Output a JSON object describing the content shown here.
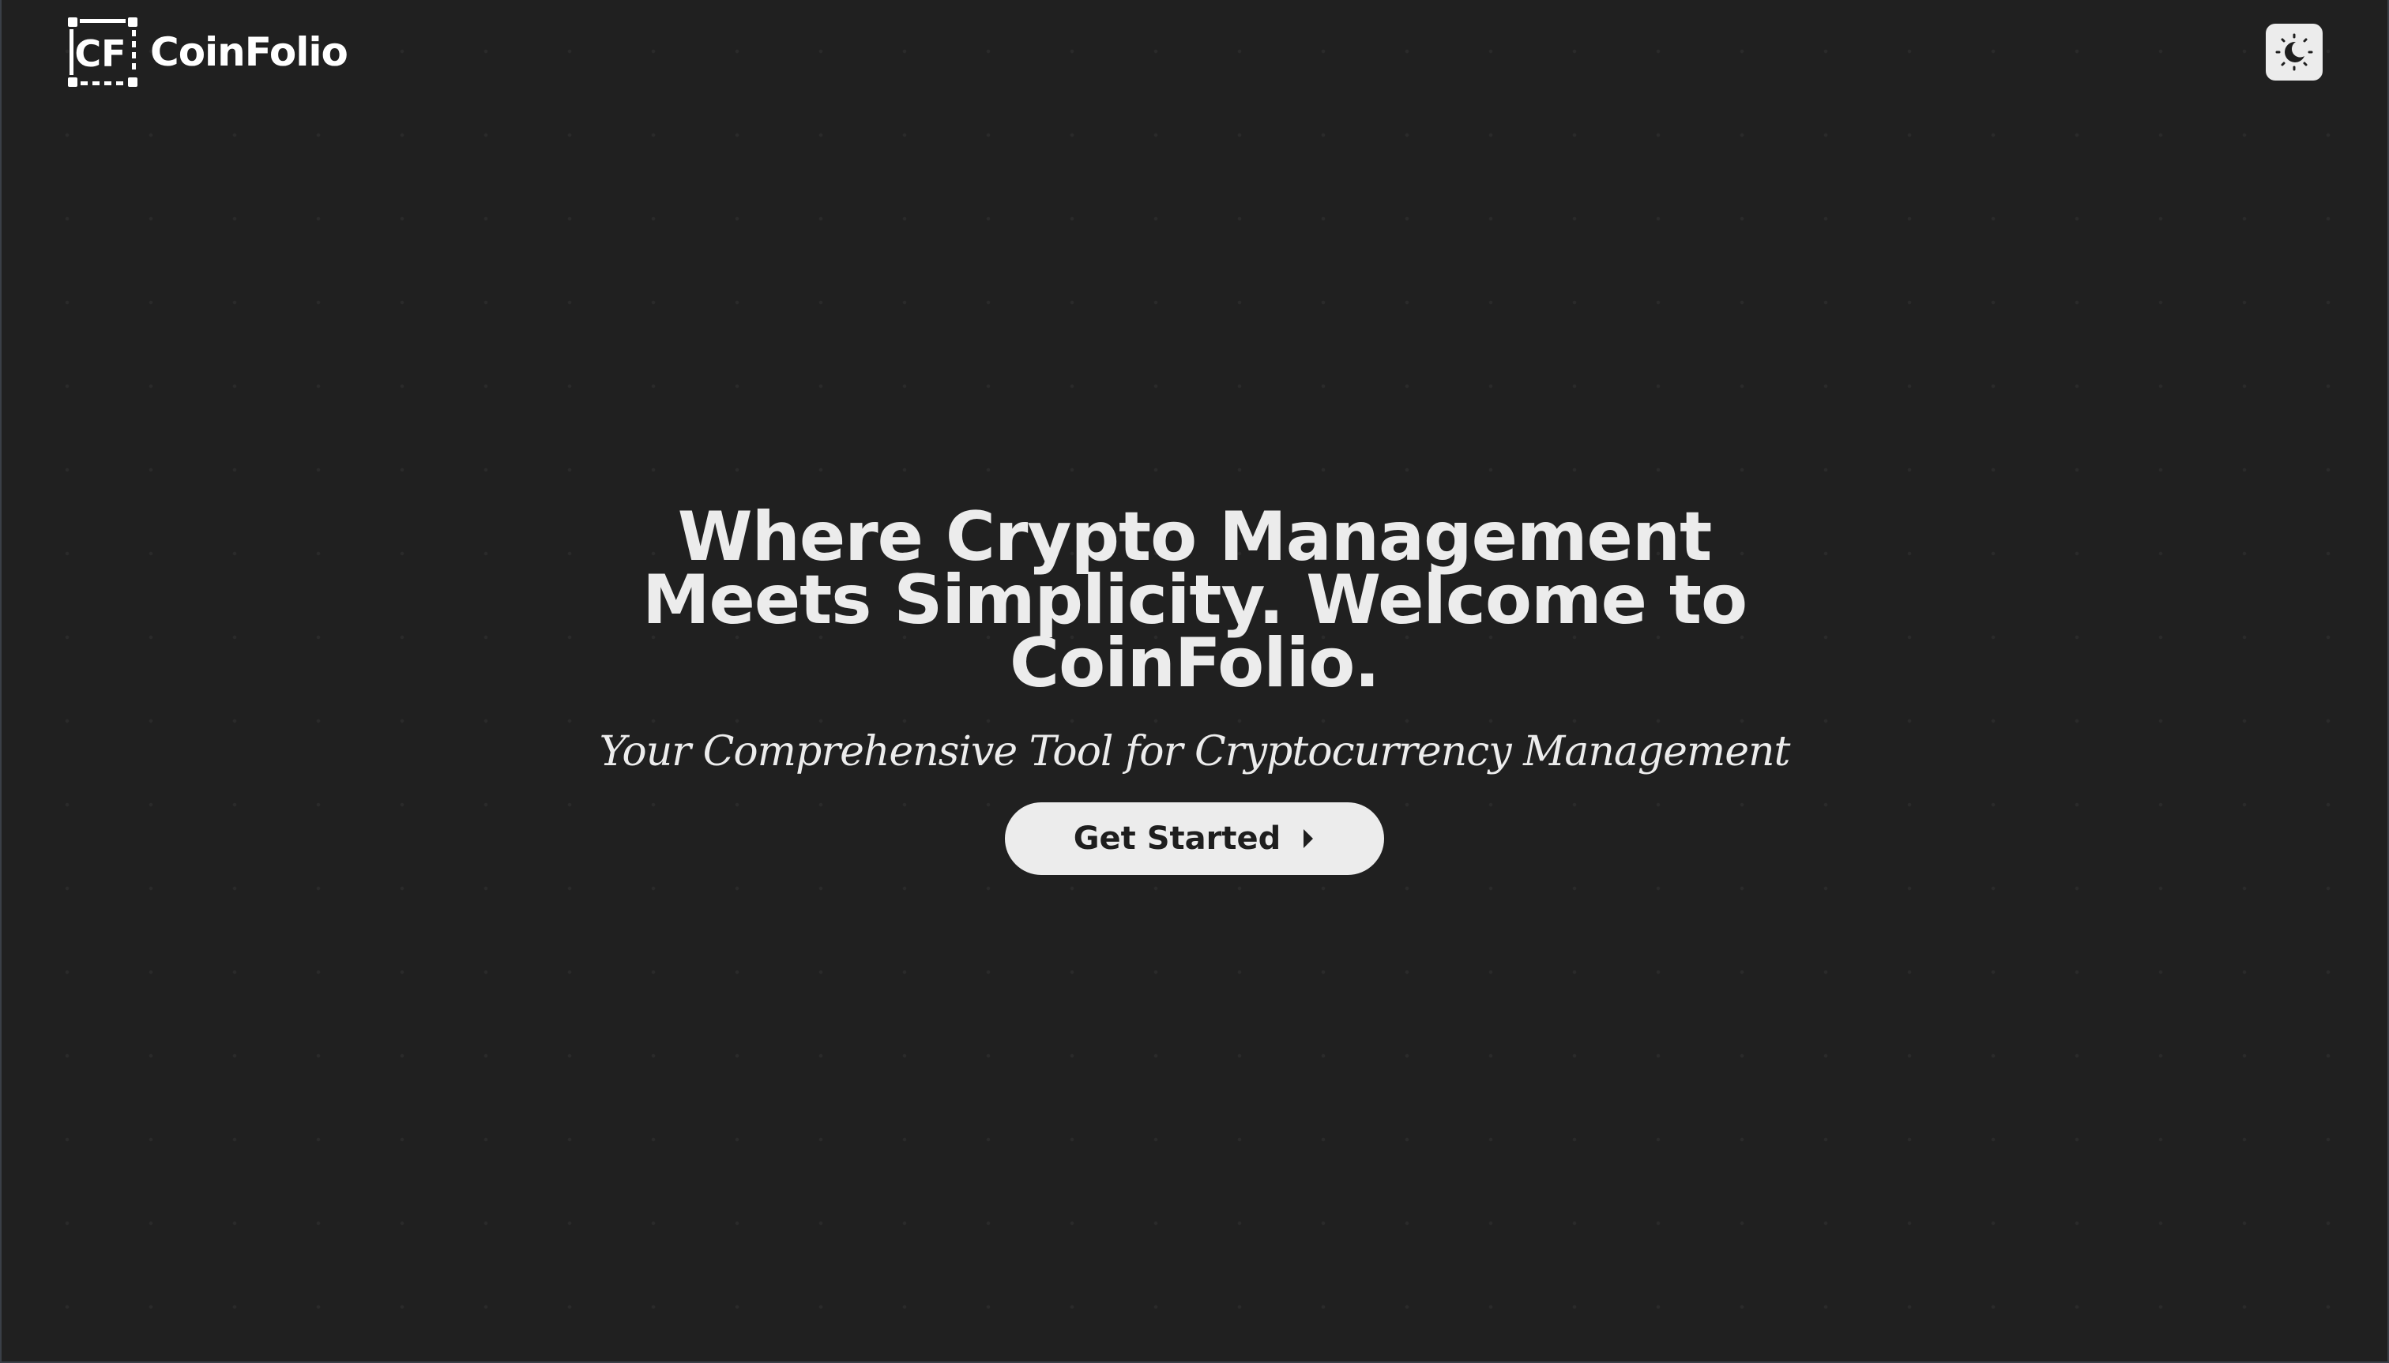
{
  "header": {
    "brand_name": "CoinFolio",
    "logo_initials": "CF",
    "logo_icon": "coinfolio-logo-icon",
    "theme_toggle_icon": "moon-icon"
  },
  "hero": {
    "title": "Where Crypto Management Meets Simplicity. Welcome to CoinFolio.",
    "subtitle": "Your Comprehensive Tool for Cryptocurrency Management",
    "cta_label": "Get Started",
    "cta_icon": "play-arrow-icon"
  },
  "colors": {
    "background": "#202020",
    "text": "#ececec",
    "button_background": "#ececec",
    "button_text": "#1e1e1e"
  }
}
